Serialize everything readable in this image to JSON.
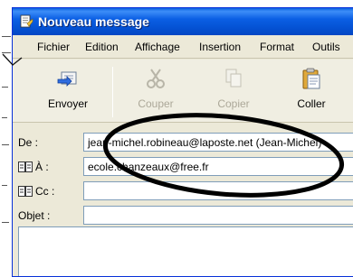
{
  "window": {
    "title": "Nouveau message"
  },
  "menu": {
    "items": [
      "Fichier",
      "Edition",
      "Affichage",
      "Insertion",
      "Format",
      "Outils"
    ]
  },
  "toolbar": {
    "send_label": "Envoyer",
    "cut_label": "Couper",
    "copy_label": "Copier",
    "paste_label": "Coller"
  },
  "headers": {
    "from_label": "De :",
    "from_value": "jean-michel.robineau@laposte.net    (Jean-Michel)",
    "to_label": "À :",
    "to_value": "ecole.chanzeaux@free.fr",
    "cc_label": "Cc :",
    "cc_value": "",
    "subject_label": "Objet :",
    "subject_value": ""
  },
  "colors": {
    "title_bar": "#0553d5",
    "highlight_ellipse": "#000000"
  }
}
